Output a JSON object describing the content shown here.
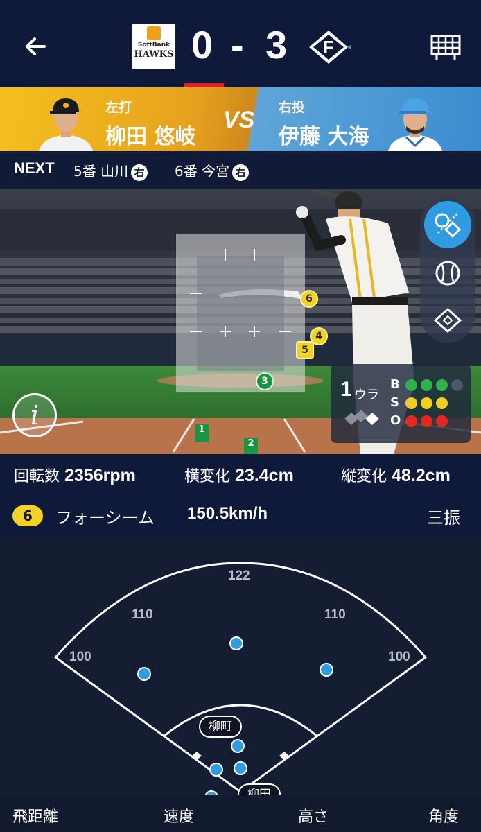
{
  "header": {
    "home_team_logo_text": [
      "SoftBank",
      "HAWKS"
    ],
    "home_score": "0",
    "separator": "-",
    "away_score": "3",
    "away_team_logo_text": "F"
  },
  "matchup": {
    "batter_side": "左打",
    "batter_name": "柳田 悠岐",
    "vs": "VS",
    "pitcher_side": "右投",
    "pitcher_name": "伊藤 大海"
  },
  "next": {
    "label": "NEXT",
    "batters": [
      {
        "order": "5番 山川",
        "hand": "右"
      },
      {
        "order": "6番 今宮",
        "hand": "右"
      }
    ]
  },
  "pitch_view": {
    "pitches": [
      {
        "number": "6",
        "color": "yellow"
      },
      {
        "number": "4",
        "color": "yellow"
      },
      {
        "number": "5",
        "color": "yellow"
      },
      {
        "number": "3",
        "color": "green"
      },
      {
        "number": "1",
        "color": "green"
      },
      {
        "number": "2",
        "color": "green"
      }
    ],
    "count": {
      "inning": "1",
      "half": "ウラ",
      "balls_label": "B",
      "strikes_label": "S",
      "outs_label": "O",
      "balls": 3,
      "strikes": 3,
      "outs": 3,
      "colors": {
        "ball": "#2fb24a",
        "strike": "#f2cf1f",
        "out": "#e2281f",
        "off": "#4d5566"
      }
    },
    "views": [
      "pitch-trajectory-icon",
      "ball-icon",
      "field-icon"
    ],
    "info_label": "i"
  },
  "stats": {
    "spin_label": "回転数",
    "spin_value": "2356rpm",
    "hbreak_label": "横変化",
    "hbreak_value": "23.4cm",
    "vbreak_label": "縦変化",
    "vbreak_value": "48.2cm"
  },
  "pitch": {
    "number": "6",
    "type": "フォーシーム",
    "speed": "150.5km/h",
    "result": "三振"
  },
  "field": {
    "distances": [
      "122",
      "110",
      "110",
      "100",
      "100"
    ],
    "fielder_tags": [
      "柳町",
      "柳田"
    ]
  },
  "bottom_tabs": [
    "飛距離",
    "速度",
    "高さ",
    "角度"
  ],
  "colors": {
    "header_bg": "#0f1a3a",
    "accent_red": "#e0201e",
    "hit_dot": "#2e9be3",
    "home_gold": "#f4c01e",
    "away_blue": "#3a8cd0"
  }
}
